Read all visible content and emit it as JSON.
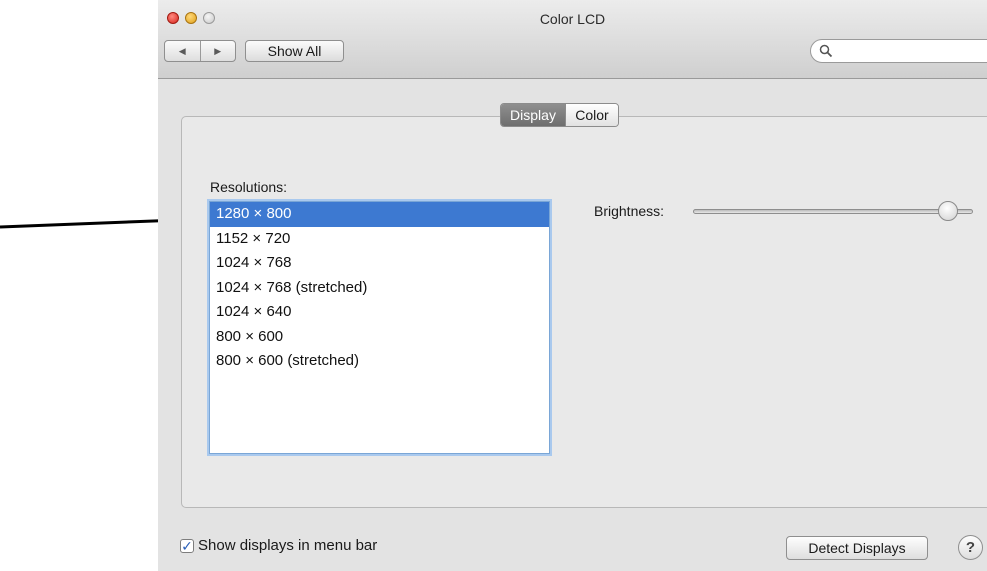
{
  "window": {
    "title": "Color LCD"
  },
  "toolbar": {
    "back_icon": "◀",
    "forward_icon": "▶",
    "show_all_label": "Show All",
    "search_placeholder": ""
  },
  "tabs": [
    {
      "label": "Display",
      "active": true
    },
    {
      "label": "Color",
      "active": false
    }
  ],
  "resolutions": {
    "label": "Resolutions:",
    "items": [
      "1280 × 800",
      "1152 × 720",
      "1024 × 768",
      "1024 × 768 (stretched)",
      "1024 × 640",
      "800 × 600",
      "800 × 600 (stretched)"
    ],
    "selected": "1280 × 800"
  },
  "brightness": {
    "label": "Brightness:",
    "value_fraction": 0.92
  },
  "footer": {
    "show_in_menu_bar_label": "Show displays in menu bar",
    "show_in_menu_bar_checked": true,
    "detect_label": "Detect Displays",
    "help_label": "?"
  },
  "colors": {
    "selection": "#3d79d1",
    "window_bg": "#e3e3e3",
    "arrow": "#000000"
  }
}
